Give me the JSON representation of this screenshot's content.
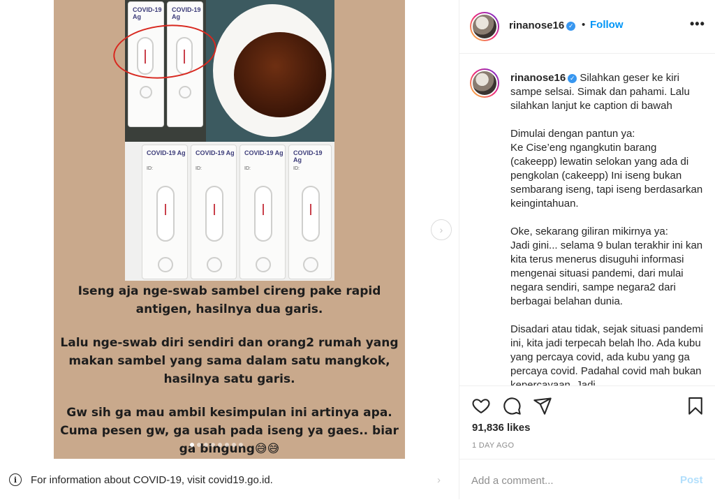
{
  "post": {
    "image_caption_lines": [
      "Iseng aja nge-swab sambel cireng pake rapid antigen, hasilnya dua garis.",
      "Lalu nge-swab diri sendiri dan orang2 rumah yang makan sambel yang sama dalam satu mangkok, hasilnya satu garis.",
      "Gw sih ga mau ambil kesimpulan ini artinya apa. Cuma pesen gw, ga usah pada iseng ya gaes.. biar ga bingung😅😅"
    ],
    "kit_label": "COVID-19 Ag",
    "kit_id": "ID:",
    "carousel_count": 8,
    "carousel_active_index": 0,
    "next_icon": "chevron-right-icon"
  },
  "covid_notice": {
    "icon": "info-icon",
    "text": "For information about COVID-19, visit covid19.go.id."
  },
  "header": {
    "username": "rinanose16",
    "verified": true,
    "follow_label": "Follow",
    "more_label": "•••"
  },
  "caption": {
    "username": "rinanose16",
    "paragraphs": [
      "Silahkan geser ke kiri sampe selsai. Simak dan pahami. Lalu silahkan lanjut ke caption di bawah",
      "Dimulai dengan pantun ya:\nKe Cise’eng ngangkutin barang (cakeepp) lewatin selokan yang ada di pengkolan (cakeepp) Ini iseng bukan sembarang iseng, tapi iseng berdasarkan keingintahuan.",
      "Oke, sekarang giliran mikirnya ya:\nJadi gini... selama 9 bulan terakhir ini kan kita terus menerus disuguhi informasi mengenai situasi pandemi, dari mulai negara sendiri, sampe negara2 dari berbagai belahan dunia.",
      "Disadari atau tidak, sejak situasi pandemi ini, kita jadi terpecah belah lho. Ada kubu yang percaya covid, ada kubu yang ga percaya covid. Padahal covid mah bukan kepercayaan. Jadi"
    ]
  },
  "actions": {
    "icons": [
      "heart-icon",
      "comment-icon",
      "share-icon",
      "bookmark-icon"
    ],
    "likes": "91,836 likes",
    "date": "1 DAY AGO"
  },
  "comment_box": {
    "placeholder": "Add a comment...",
    "post_label": "Post"
  },
  "colors": {
    "link": "#0095f6",
    "post_disabled": "#b2dffc",
    "verified": "#3897f0",
    "kit_line": "#c9404b",
    "annotation_circle": "#d8281f"
  }
}
